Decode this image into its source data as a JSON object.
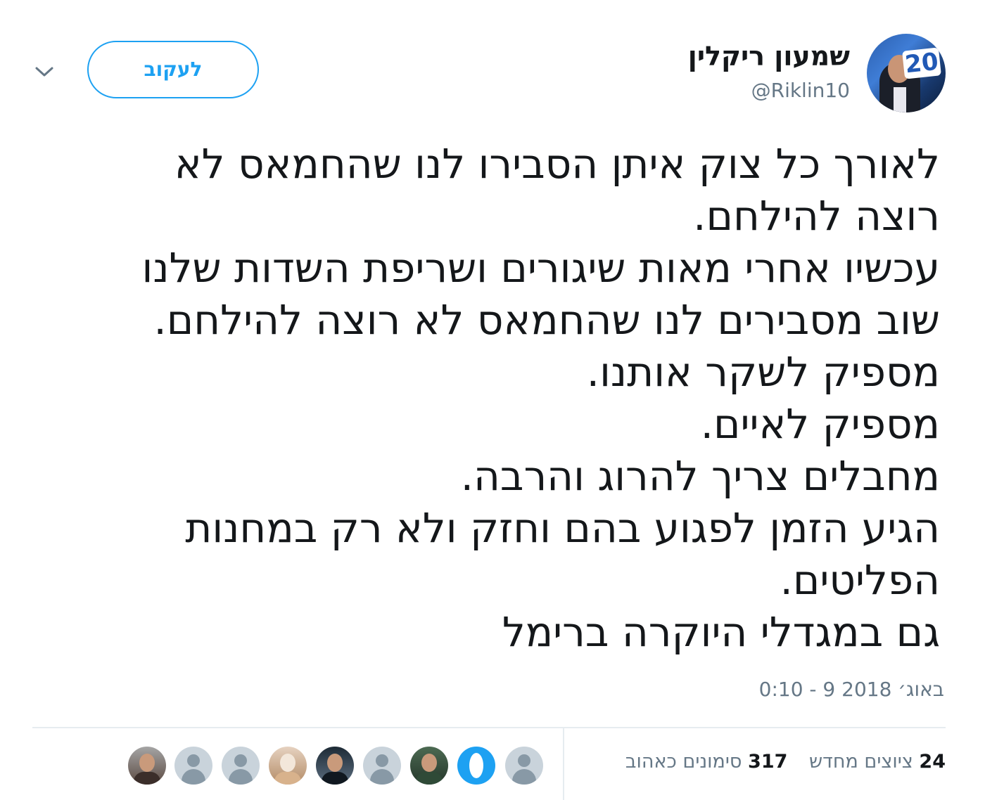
{
  "user": {
    "display_name": "שמעון ריקלין",
    "handle": "@Riklin10",
    "avatar_icon": "profile-photo",
    "avatar_badge": "20"
  },
  "actions": {
    "follow_label": "לעקוב",
    "menu_icon": "chevron-down-icon"
  },
  "tweet": {
    "lines": [
      "לאורך כל צוק איתן הסבירו לנו שהחמאס לא",
      "רוצה להילחם.",
      "עכשיו אחרי מאות שיגורים ושריפת השדות שלנו",
      "שוב מסבירים לנו שהחמאס לא רוצה להילחם.",
      "מספיק לשקר אותנו.",
      "מספיק לאיים.",
      "מחבלים צריך להרוג והרבה.",
      "הגיע הזמן לפגוע בהם וחזק ולא רק במחנות",
      "הפליטים.",
      "גם במגדלי היוקרה ברימל"
    ],
    "timestamp": "0:10 - 9 באוג׳ 2018"
  },
  "stats": {
    "retweets_count": "24",
    "retweets_label": "ציוצים מחדש",
    "likes_count": "317",
    "likes_label": "סימונים כאהוב"
  },
  "colors": {
    "accent": "#1da1f2",
    "muted": "#657786",
    "divider": "#e6ecf0"
  }
}
